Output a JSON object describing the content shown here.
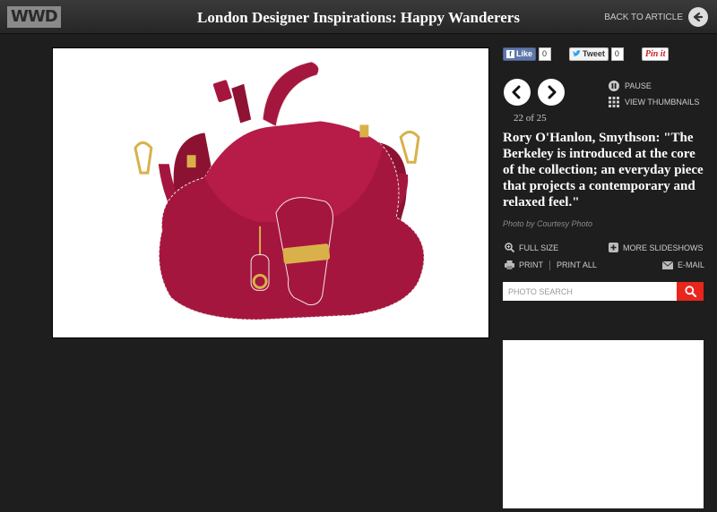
{
  "header": {
    "logo": "WWD",
    "title": "London Designer Inspirations: Happy Wanderers",
    "back_label": "BACK TO ARTICLE"
  },
  "social": {
    "like_label": "Like",
    "like_count": "0",
    "tweet_label": "Tweet",
    "tweet_count": "0",
    "pin_label": "Pin it"
  },
  "slideshow": {
    "counter": "22 of 25",
    "pause_label": "PAUSE",
    "thumbnails_label": "VIEW THUMBNAILS",
    "caption": "Rory O'Hanlon, Smythson: \"The Berkeley is introduced at the core of the collection; an everyday piece that projects a contemporary and relaxed feel.\"",
    "credit": "Photo by Courtesy Photo"
  },
  "tools": {
    "full_size": "FULL SIZE",
    "more_slideshows": "MORE SLIDESHOWS",
    "print": "PRINT",
    "print_all": "PRINT ALL",
    "email": "E-MAIL"
  },
  "search": {
    "placeholder": "PHOTO SEARCH"
  },
  "colors": {
    "bag": "#a5163e",
    "bag_dark": "#7d0f2d",
    "hardware": "#d9b14a",
    "search_button": "#e8261d"
  },
  "icons": [
    "back-arrow-icon",
    "facebook-icon",
    "twitter-icon",
    "prev-arrow-icon",
    "next-arrow-icon",
    "pause-icon",
    "grid-icon",
    "zoom-icon",
    "plus-icon",
    "printer-icon",
    "envelope-icon",
    "search-icon"
  ]
}
